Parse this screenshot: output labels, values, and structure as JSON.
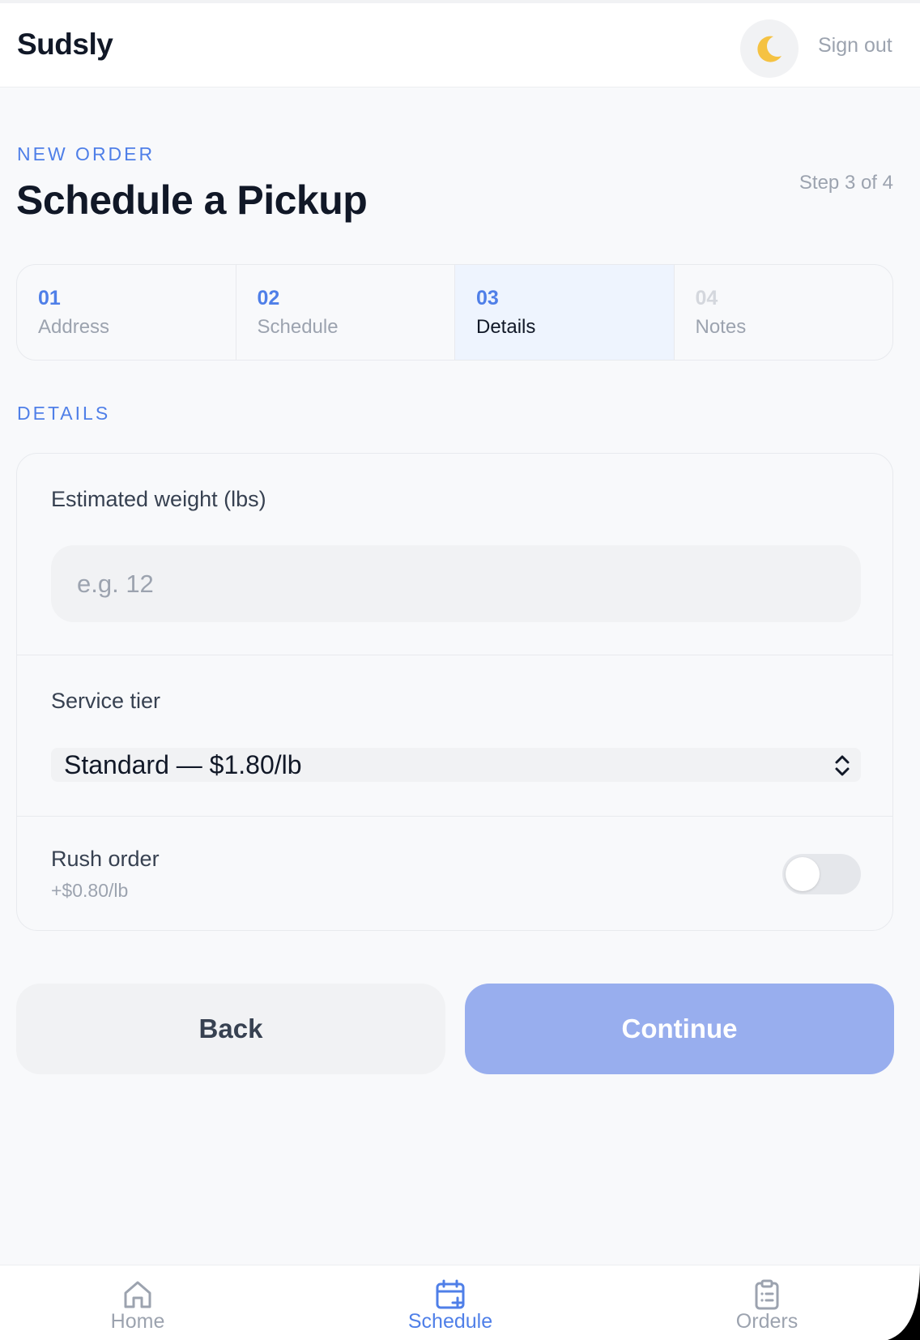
{
  "app": {
    "brand": "Sudsly",
    "sign_out": "Sign out",
    "theme_icon": "moon-icon"
  },
  "page": {
    "eyebrow": "NEW ORDER",
    "title": "Schedule a Pickup",
    "step_count": "Step 3 of 4"
  },
  "steps": [
    {
      "num": "01",
      "label": "Address",
      "state": "done"
    },
    {
      "num": "02",
      "label": "Schedule",
      "state": "done"
    },
    {
      "num": "03",
      "label": "Details",
      "state": "active"
    },
    {
      "num": "04",
      "label": "Notes",
      "state": "upcoming"
    }
  ],
  "details": {
    "section_label": "DETAILS",
    "weight": {
      "label": "Estimated weight (lbs)",
      "value": "",
      "placeholder": "e.g. 12"
    },
    "tier": {
      "label": "Service tier",
      "selected": "Standard — $1.80/lb"
    },
    "rush": {
      "label": "Rush order",
      "sub": "+$0.80/lb",
      "enabled": false
    }
  },
  "actions": {
    "back": "Back",
    "continue": "Continue"
  },
  "nav": {
    "items": [
      {
        "label": "Home",
        "icon": "home-icon",
        "active": false
      },
      {
        "label": "Schedule",
        "icon": "calendar-plus-icon",
        "active": true
      },
      {
        "label": "Orders",
        "icon": "clipboard-list-icon",
        "active": false
      }
    ]
  },
  "colors": {
    "accent": "#4f7fe8",
    "continue_disabled": "#98aeee",
    "background": "#f8f9fb",
    "text": "#111827",
    "muted": "#9ca3af"
  }
}
